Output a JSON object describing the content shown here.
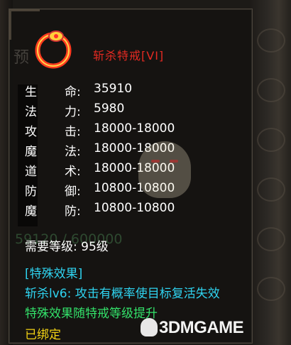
{
  "item": {
    "name": "斩杀特戒[VI]",
    "icon": "ring-icon",
    "title_color": "#e52a22"
  },
  "stats": [
    {
      "c1": "生",
      "c2": "命:",
      "value": "35910"
    },
    {
      "c1": "法",
      "c2": "力:",
      "value": "5980"
    },
    {
      "c1": "攻",
      "c2": "击:",
      "value": "18000-18000"
    },
    {
      "c1": "魔",
      "c2": "法:",
      "value": "18000-18000"
    },
    {
      "c1": "道",
      "c2": "术:",
      "value": "18000-18000"
    },
    {
      "c1": "防",
      "c2": "御:",
      "value": "10800-10800"
    },
    {
      "c1": "魔",
      "c2": "防:",
      "value": "10800-10800"
    }
  ],
  "requirement": "需要等级: 95级",
  "special": {
    "heading": "[特殊效果]",
    "description": "斩杀lv6: 攻击有概率使目标复活失效",
    "upgrade_note": "特殊效果随特戒等级提升",
    "color": "#2fd3f0"
  },
  "bound_status": "已绑定",
  "background_text": {
    "faint_number": "59120 / 600000",
    "preview_char": "预"
  },
  "watermark": {
    "text": "3DMGAME"
  }
}
